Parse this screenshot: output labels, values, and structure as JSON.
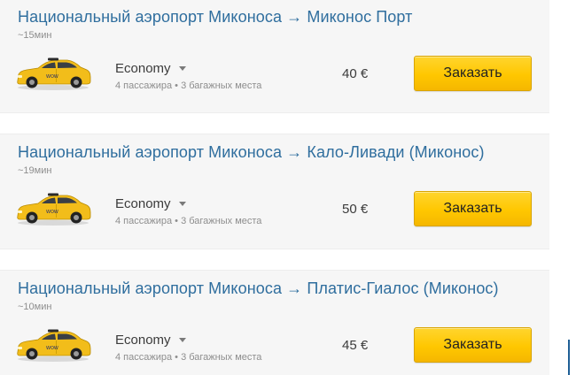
{
  "transfers": [
    {
      "route": "Национальный аэропорт Миконоса → Миконос Порт",
      "duration": "~15мин",
      "car_class": "Economy",
      "capacity": "4 пассажира • 3 багажных места",
      "price": "40 €",
      "order_label": "Заказать"
    },
    {
      "route": "Национальный аэропорт Миконоса → Кало-Ливади (Миконос)",
      "duration": "~19мин",
      "car_class": "Economy",
      "capacity": "4 пассажира • 3 багажных места",
      "price": "50 €",
      "order_label": "Заказать"
    },
    {
      "route": "Национальный аэропорт Миконоса → Платис-Гиалос (Миконос)",
      "duration": "~10мин",
      "car_class": "Economy",
      "capacity": "4 пассажира • 3 багажных места",
      "price": "45 €",
      "order_label": "Заказать"
    }
  ],
  "icons": {
    "car": "taxi-car-icon",
    "caret": "caret-down-icon"
  },
  "colors": {
    "route_link": "#2f6e9e",
    "button": "#ffc700",
    "car_body": "#f2bd1a",
    "card_bg": "#f6f6f6"
  }
}
